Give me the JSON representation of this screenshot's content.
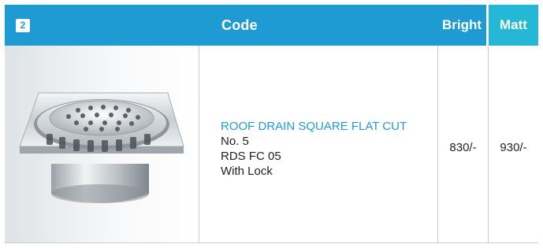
{
  "header": {
    "item_number": "2",
    "code_label": "Code",
    "bright_label": "Bright",
    "matt_label": "Matt"
  },
  "product": {
    "image_alt": "roof-drain-square-flat-cut",
    "title": "ROOF DRAIN SQUARE FLAT CUT",
    "number": "No. 5",
    "code": "RDS FC 05",
    "feature": "With Lock",
    "price_bright": "830/-",
    "price_matt": "930/-"
  },
  "colors": {
    "header_blue": "#1f9bd4",
    "header_matt": "#25b8d6",
    "title_blue": "#1f9bd4"
  }
}
